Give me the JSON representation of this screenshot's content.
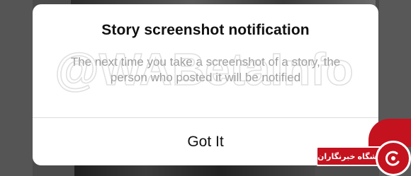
{
  "dialog": {
    "title": "Story screenshot notification",
    "message": "The next time you take a screenshot of a story, the person who posted it will be notified",
    "button_label": "Got It"
  },
  "watermark": {
    "text": "@WABetaInfo"
  },
  "badge": {
    "text": "باشگاه خبرنگاران",
    "icon": "news-club-logo-icon"
  },
  "colors": {
    "dialog_background": "#ffffff",
    "title_text": "#111111",
    "message_text": "#9a9a9a",
    "divider": "#dbdbdb",
    "badge_red": "#c4121f"
  }
}
